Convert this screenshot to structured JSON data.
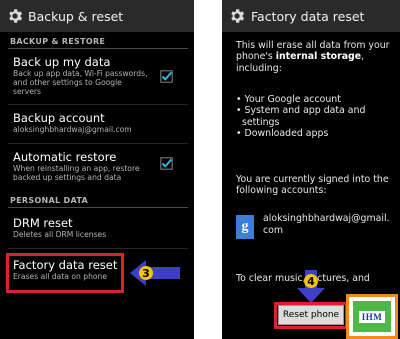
{
  "left": {
    "title": "Backup & reset",
    "sections": [
      "BACKUP & RESTORE",
      "PERSONAL DATA"
    ],
    "items": [
      {
        "title": "Back up my data",
        "summary": "Back up app data, Wi-Fi passwords, and other settings to Google servers",
        "checked": true
      },
      {
        "title": "Backup account",
        "summary": "aloksinghbhardwaj@gmail.com"
      },
      {
        "title": "Automatic restore",
        "summary": "When reinstalling an app, restore backed up settings and data",
        "checked": true
      },
      {
        "title": "DRM reset",
        "summary": "Deletes all DRM licenses"
      },
      {
        "title": "Factory data reset",
        "summary": "Erases all data on phone"
      }
    ],
    "step_badge": "3"
  },
  "right": {
    "title": "Factory data reset",
    "intro_pre": "This will erase all data from your phone's ",
    "intro_bold": "internal storage",
    "intro_post": ", including:",
    "bullets": [
      "• Your Google account",
      "• System and app data and",
      "  settings",
      "• Downloaded apps"
    ],
    "signed_in": "You are currently signed into the following accounts:",
    "account_icon": "g",
    "account": "aloksinghbhardwaj@gmail.com",
    "clear_text": "To clear music, pictures, and",
    "step_badge": "4",
    "reset_button": "Reset phone"
  },
  "logo": {
    "text": "IHM"
  },
  "colors": {
    "accent_check": "#33b5e5",
    "highlight": "#e0202a",
    "arrow": "#3d3fc9",
    "badge": "#f5c400",
    "logo_border": "#f28a1e",
    "logo_bg": "#4fb948"
  }
}
